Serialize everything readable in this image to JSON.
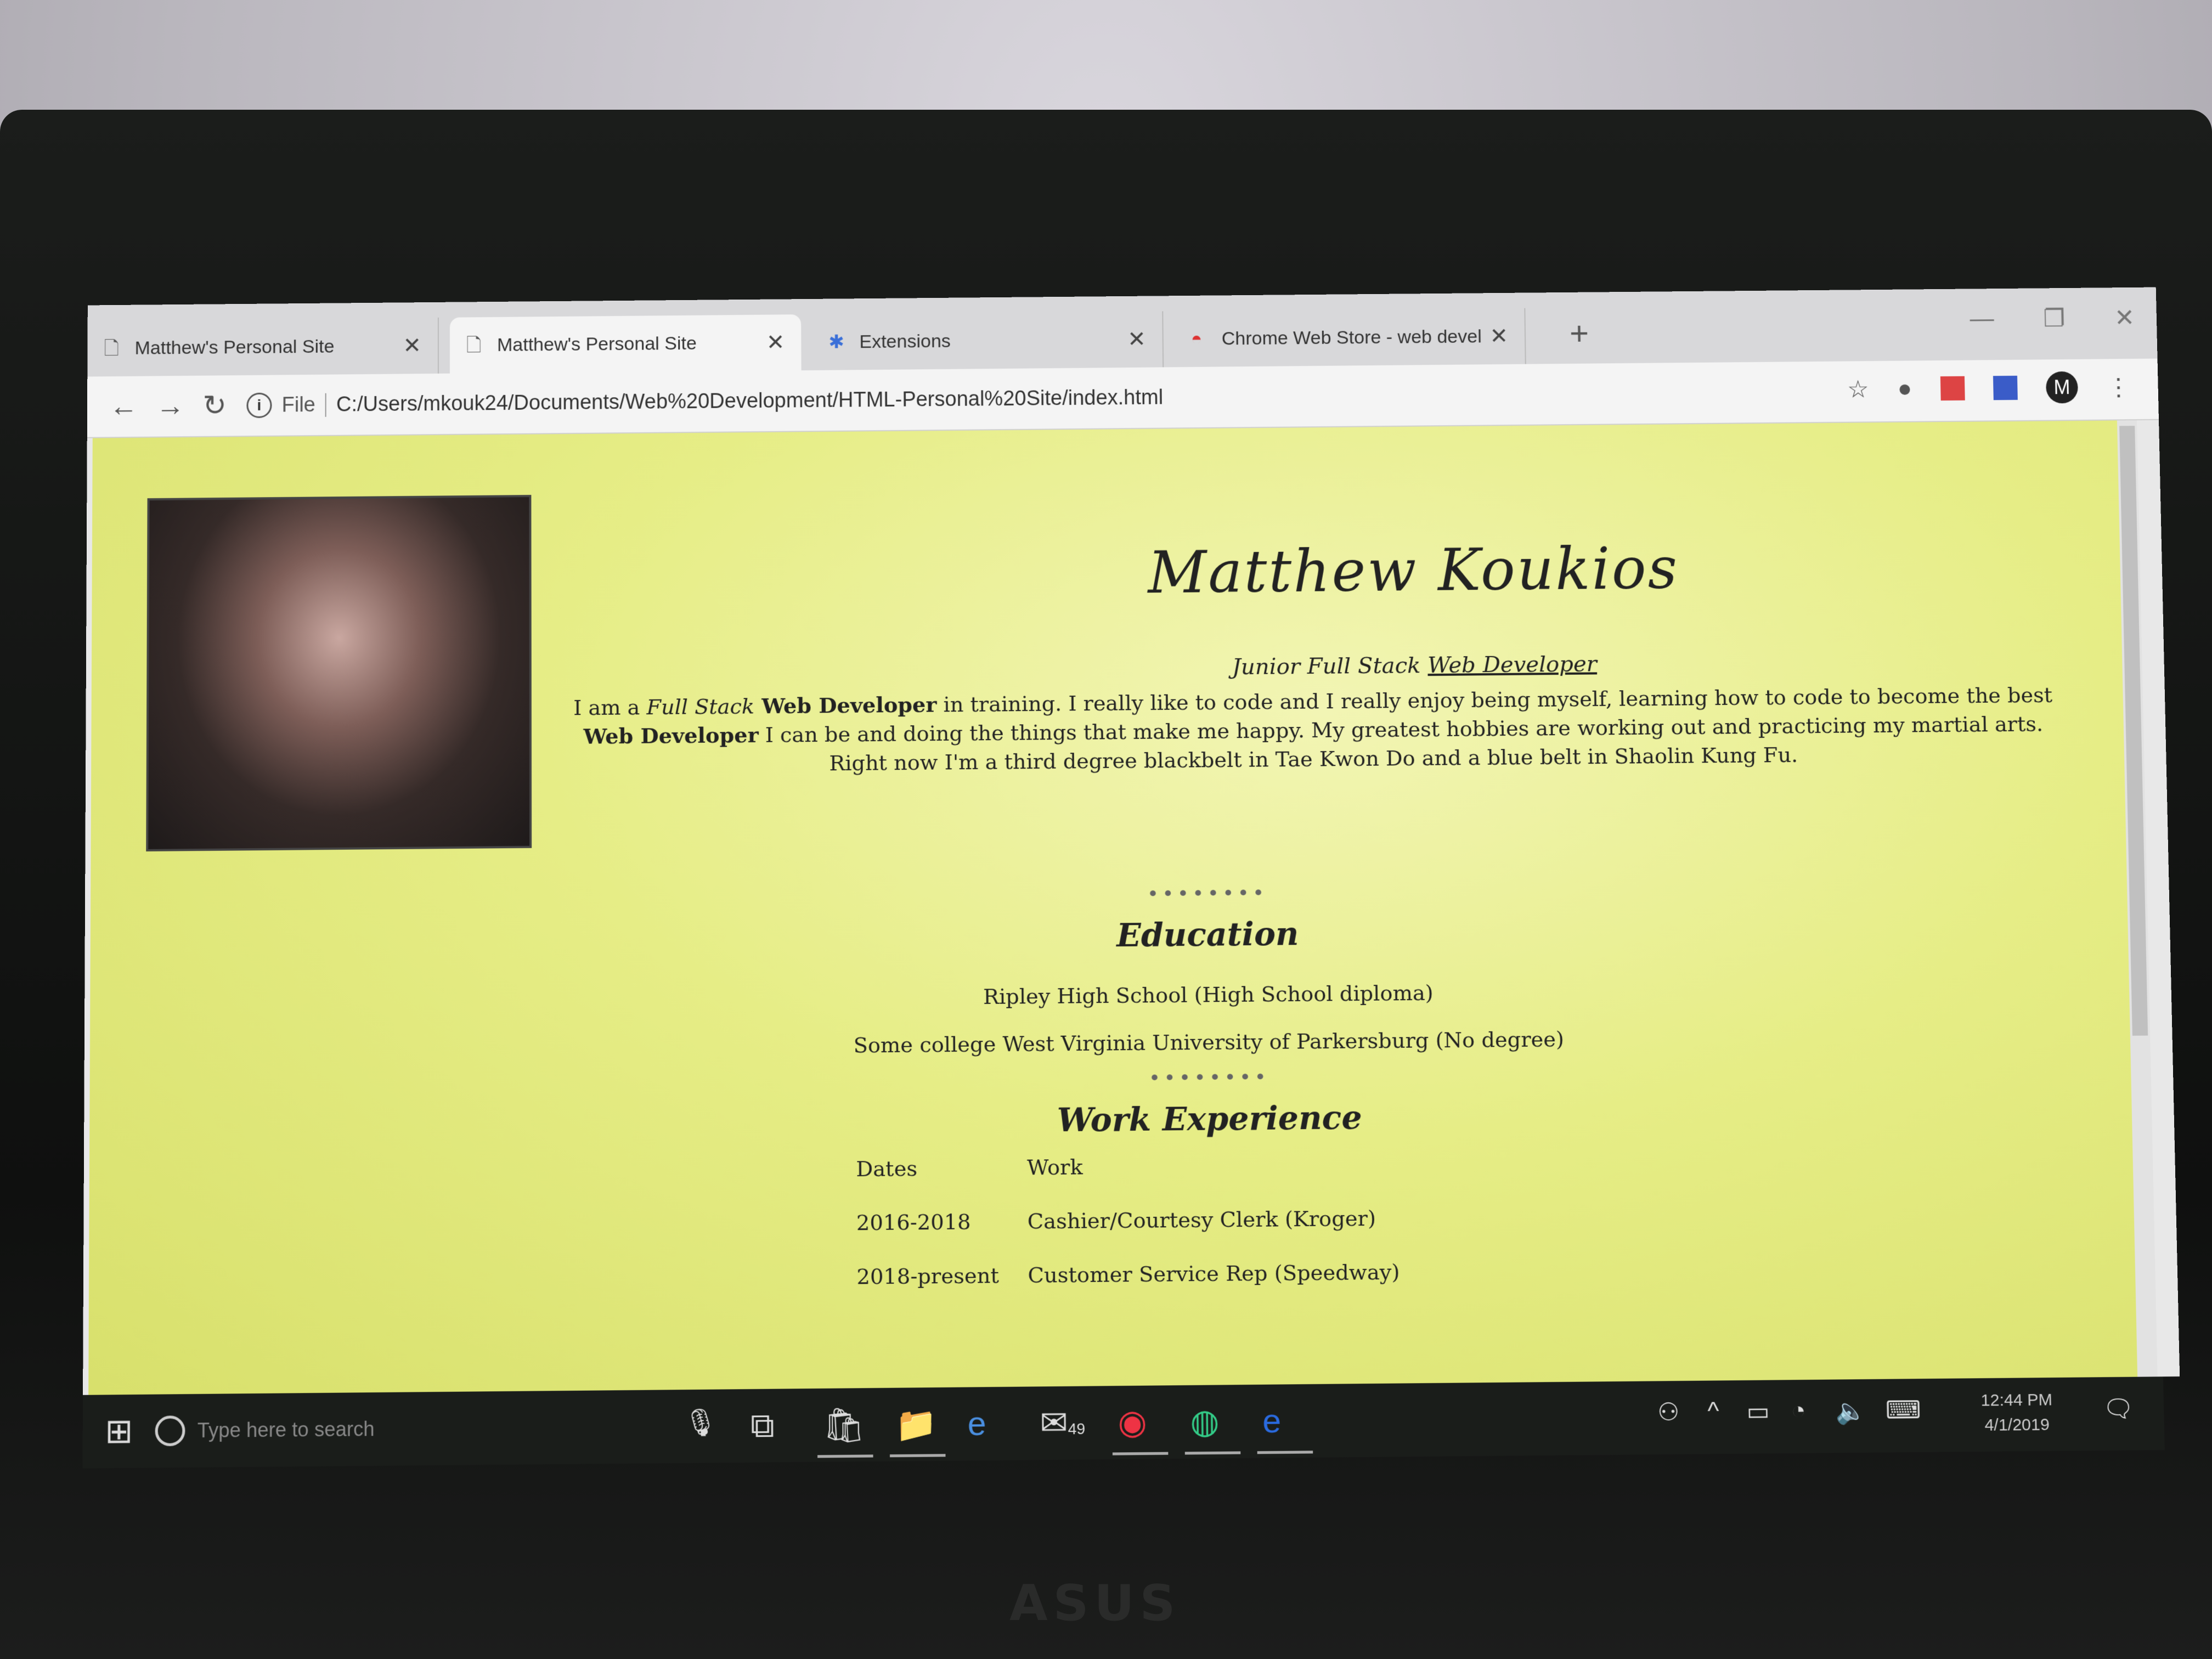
{
  "browser": {
    "tabs": [
      {
        "label": "Matthew's Personal Site",
        "icon": "page-icon",
        "active": false
      },
      {
        "label": "Matthew's Personal Site",
        "icon": "page-icon",
        "active": true
      },
      {
        "label": "Extensions",
        "icon": "puzzle-icon",
        "active": false
      },
      {
        "label": "Chrome Web Store - web develo",
        "icon": "webstore-icon",
        "active": false
      }
    ],
    "file_label": "File",
    "url": "C:/Users/mkouk24/Documents/Web%20Development/HTML-Personal%20Site/index.html",
    "profile_initial": "M"
  },
  "page": {
    "name": "Matthew Koukios",
    "subtitle_prefix": "Junior Full Stack",
    "subtitle_link": "Web Developer",
    "bio": {
      "p1": "I am a ",
      "p1_italic": "Full Stack",
      "p1_bold": " Web Developer",
      "p2": " in training. I really like to code and I really enjoy being myself, learning how to code to become the best ",
      "p2_bold": "Web Developer",
      "p3": " I can be and doing the things that make me happy. My greatest hobbies are working out and practicing my martial arts. Right now I'm a third degree blackbelt in Tae Kwon Do and a blue belt in Shaolin Kung Fu."
    },
    "divider": "••••••••",
    "education_heading": "Education",
    "education": [
      "Ripley High School (High School diploma)",
      "Some college West Virginia University of Parkersburg (No degree)"
    ],
    "work_heading": "Work Experience",
    "work_table": {
      "headers": [
        "Dates",
        "Work"
      ],
      "rows": [
        [
          "2016-2018",
          "Cashier/Courtesy Clerk (Kroger)"
        ],
        [
          "2018-present",
          "Customer Service Rep (Speedway)"
        ]
      ]
    }
  },
  "taskbar": {
    "search_placeholder": "Type here to search",
    "mail_badge": "49",
    "time": "12:44 PM",
    "date": "4/1/2019"
  },
  "bezel_brand": "ASUS"
}
